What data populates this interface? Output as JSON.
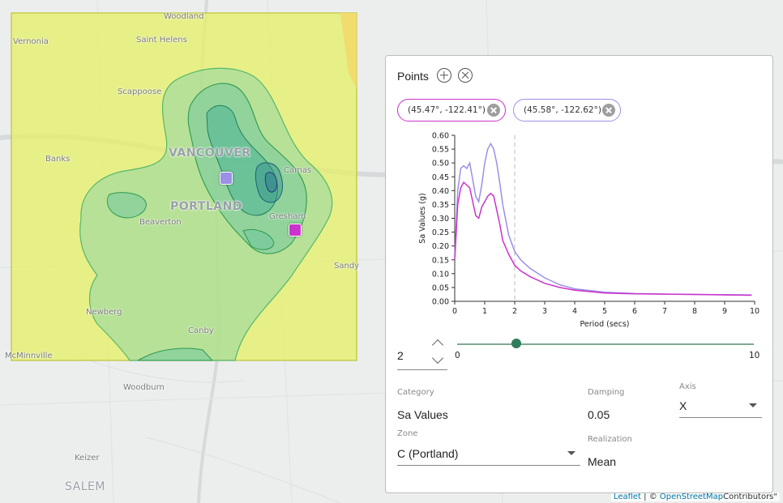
{
  "map": {
    "places": [
      {
        "key": "woodland",
        "label": "Woodland"
      },
      {
        "key": "vernonia",
        "label": "Vernonia"
      },
      {
        "key": "saint_helens",
        "label": "Saint Helens"
      },
      {
        "key": "scappoose",
        "label": "Scappoose"
      },
      {
        "key": "vancouver",
        "label": "VANCOUVER"
      },
      {
        "key": "camas",
        "label": "Camas"
      },
      {
        "key": "banks",
        "label": "Banks"
      },
      {
        "key": "portland",
        "label": "PORTLAND"
      },
      {
        "key": "gresham",
        "label": "Gresham"
      },
      {
        "key": "beaverton",
        "label": "Beaverton"
      },
      {
        "key": "sandy",
        "label": "Sandy"
      },
      {
        "key": "newberg",
        "label": "Newberg"
      },
      {
        "key": "canby",
        "label": "Canby"
      },
      {
        "key": "mcminnville",
        "label": "McMinnville"
      },
      {
        "key": "woodburn",
        "label": "Woodburn"
      },
      {
        "key": "keizer",
        "label": "Keizer"
      },
      {
        "key": "salem",
        "label": "SALEM"
      }
    ],
    "attribution": {
      "leaflet": "Leaflet",
      "sep": " | © ",
      "osm": "OpenStreetMap",
      "rest": "Contributors\""
    }
  },
  "colors": {
    "point1": "#cc33cc",
    "point2": "#9b8fe6",
    "zone_fill": "#e5ef6a",
    "contour_fill": "#8fd6a4",
    "contour_line": "#2f9a4f"
  },
  "panel": {
    "title": "Points",
    "add_icon": "plus-icon",
    "clear_icon": "close-icon",
    "chips": [
      {
        "label": "(45.47°, -122.41°)",
        "color": "#cc33cc"
      },
      {
        "label": "(45.58°, -122.62°)",
        "color": "#9b8fe6"
      }
    ],
    "period": {
      "value": "2",
      "slider_min": "0",
      "slider_max": "10",
      "fraction": 0.2
    },
    "fields": {
      "category_label": "Category",
      "category_value": "Sa Values",
      "damping_label": "Damping",
      "damping_value": "0.05",
      "axis_label": "Axis",
      "axis_value": "X",
      "zone_label": "Zone",
      "zone_value": "C (Portland)",
      "realization_label": "Realization",
      "realization_value": "Mean"
    }
  },
  "chart_data": {
    "type": "line",
    "title": "",
    "xlabel": "Period (secs)",
    "ylabel": "Sa Values (g)",
    "xlim": [
      0,
      10
    ],
    "ylim": [
      0,
      0.6
    ],
    "xticks": [
      "0",
      "1",
      "2",
      "3",
      "4",
      "5",
      "6",
      "7",
      "8",
      "9",
      "10"
    ],
    "yticks": [
      "0.00",
      "0.05",
      "0.10",
      "0.15",
      "0.20",
      "0.25",
      "0.30",
      "0.35",
      "0.40",
      "0.45",
      "0.50",
      "0.55",
      "0.60"
    ],
    "marker_x": 2,
    "series": [
      {
        "color": "#9b8fe6",
        "x": [
          0,
          0.05,
          0.1,
          0.2,
          0.3,
          0.4,
          0.5,
          0.6,
          0.7,
          0.8,
          0.9,
          1.0,
          1.1,
          1.2,
          1.3,
          1.4,
          1.5,
          1.6,
          1.8,
          2.0,
          2.2,
          2.5,
          3.0,
          3.5,
          4.0,
          5.0,
          6.0,
          7.0,
          8.0,
          9.0,
          9.9
        ],
        "y": [
          0.16,
          0.28,
          0.4,
          0.48,
          0.49,
          0.48,
          0.5,
          0.44,
          0.38,
          0.36,
          0.42,
          0.5,
          0.55,
          0.57,
          0.55,
          0.5,
          0.43,
          0.35,
          0.24,
          0.18,
          0.15,
          0.12,
          0.085,
          0.06,
          0.045,
          0.033,
          0.028,
          0.026,
          0.025,
          0.024,
          0.023
        ]
      },
      {
        "color": "#cc33cc",
        "x": [
          0,
          0.05,
          0.1,
          0.2,
          0.3,
          0.4,
          0.5,
          0.6,
          0.7,
          0.8,
          0.9,
          1.0,
          1.1,
          1.2,
          1.3,
          1.4,
          1.5,
          1.6,
          1.8,
          2.0,
          2.2,
          2.5,
          3.0,
          3.5,
          4.0,
          5.0,
          6.0,
          7.0,
          8.0,
          9.0,
          9.9
        ],
        "y": [
          0.15,
          0.25,
          0.35,
          0.41,
          0.43,
          0.42,
          0.41,
          0.36,
          0.31,
          0.3,
          0.34,
          0.36,
          0.38,
          0.39,
          0.38,
          0.33,
          0.28,
          0.22,
          0.17,
          0.13,
          0.11,
          0.09,
          0.065,
          0.05,
          0.04,
          0.03,
          0.027,
          0.026,
          0.025,
          0.023,
          0.022
        ]
      }
    ]
  }
}
